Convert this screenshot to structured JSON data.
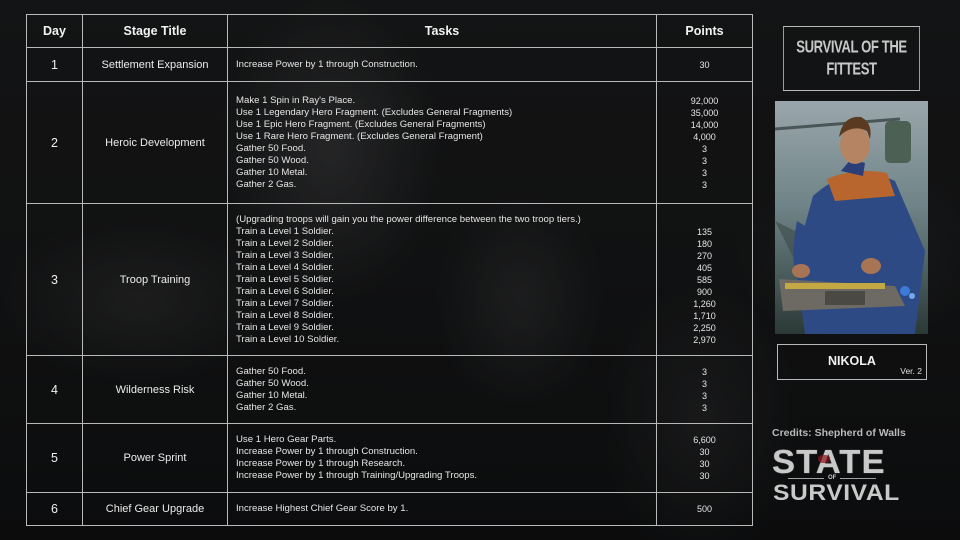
{
  "table": {
    "headers": {
      "day": "Day",
      "stage_title": "Stage Title",
      "tasks": "Tasks",
      "points": "Points"
    },
    "rows": [
      {
        "day": "1",
        "stage_title": "Settlement Expansion",
        "tasks": [
          "Increase Power by 1 through Construction."
        ],
        "points": [
          "30"
        ]
      },
      {
        "day": "2",
        "stage_title": "Heroic Development",
        "tasks": [
          "Make 1 Spin in Ray's Place.",
          "Use 1 Legendary Hero Fragment. (Excludes General Fragments)",
          "Use 1 Epic Hero Fragment. (Excludes General Fragments)",
          "Use 1 Rare Hero Fragment. (Excludes General Fragment)",
          "Gather 50 Food.",
          "Gather 50 Wood.",
          "Gather 10 Metal.",
          "Gather 2 Gas."
        ],
        "points": [
          "92,000",
          "35,000",
          "14,000",
          "4,000",
          "3",
          "3",
          "3",
          "3"
        ]
      },
      {
        "day": "3",
        "stage_title": "Troop Training",
        "note": "(Upgrading troops will gain you the power difference between the two troop tiers.)",
        "tasks": [
          "Train a Level 1 Soldier.",
          "Train a Level 2 Soldier.",
          "Train a Level 3 Soldier.",
          "Train a Level 4 Soldier.",
          "Train a Level 5 Soldier.",
          "Train a Level 6 Soldier.",
          "Train a Level 7 Soldier.",
          "Train a Level 8 Soldier.",
          "Train a Level 9 Soldier.",
          "Train a Level 10 Soldier."
        ],
        "points": [
          "135",
          "180",
          "270",
          "405",
          "585",
          "900",
          "1,260",
          "1,710",
          "2,250",
          "2,970"
        ]
      },
      {
        "day": "4",
        "stage_title": "Wilderness Risk",
        "tasks": [
          "Gather 50 Food.",
          "Gather 50 Wood.",
          "Gather 10 Metal.",
          "Gather 2 Gas."
        ],
        "points": [
          "3",
          "3",
          "3",
          "3"
        ]
      },
      {
        "day": "5",
        "stage_title": "Power Sprint",
        "tasks": [
          "Use 1 Hero Gear Parts.",
          "Increase Power by 1 through Construction.",
          "Increase Power by 1 through Research.",
          "Increase Power by 1 through Training/Upgrading Troops."
        ],
        "points": [
          "6,600",
          "30",
          "30",
          "30"
        ]
      },
      {
        "day": "6",
        "stage_title": "Chief Gear Upgrade",
        "tasks": [
          "Increase Highest Chief Gear Score by 1."
        ],
        "points": [
          "500"
        ]
      }
    ]
  },
  "sidebar": {
    "event_title_line1": "SURVIVAL OF THE",
    "event_title_line2": "FITTEST",
    "hero_portrait_icon": "hero-portrait-nikola",
    "hero_name": "NIKOLA",
    "version": "Ver. 2",
    "credits": "Credits: Shepherd of Walls",
    "logo_line1": "STATE",
    "logo_of": "OF",
    "logo_line2": "SURVIVAL"
  }
}
